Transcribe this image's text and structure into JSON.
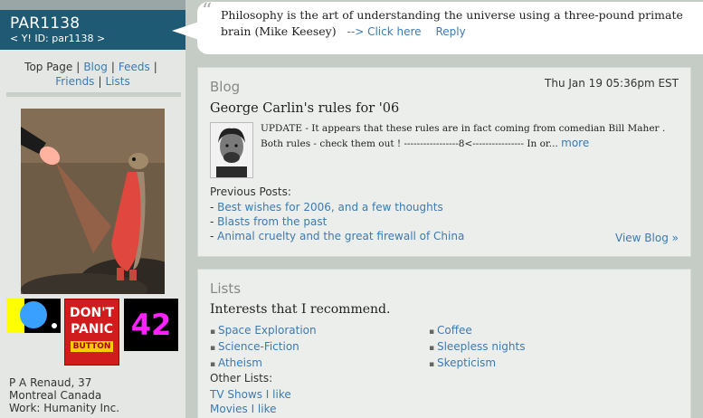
{
  "profile": {
    "name": "PAR1138",
    "yahoo_id": "< Y! ID: par1138 >",
    "info_lines": [
      "P A Renaud, 37",
      "Montreal Canada",
      "Work: Humanity Inc."
    ]
  },
  "nav": {
    "items": [
      "Top Page",
      "Blog",
      "Feeds",
      "Friends",
      "Lists"
    ],
    "separator": "|"
  },
  "badges": {
    "dont_panic": [
      "DON'T",
      "PANIC",
      "BUTTON"
    ],
    "answer": "42"
  },
  "quote": {
    "text": "Philosophy is the art of understanding the universe using a three-pound primate brain (Mike Keesey)",
    "click_link": "--> Click here",
    "reply_link": "Reply"
  },
  "blog": {
    "heading": "Blog",
    "date": "Thu Jan 19 05:36pm EST",
    "post_title": "George Carlin's rules for '06",
    "excerpt": "UPDATE - It appears that these rules are in fact coming from comedian Bill Maher . Both rules - check them out ! -----------------8<---------------- In or...",
    "more_link": "more",
    "previous_heading": "Previous Posts:",
    "previous_posts": [
      "Best wishes for 2006, and a few thoughts",
      "Blasts from the past",
      "Animal cruelty and the great firewall of China"
    ],
    "view_blog": "View Blog »"
  },
  "lists": {
    "heading": "Lists",
    "subheading": "Interests that I recommend.",
    "col1": [
      "Space Exploration",
      "Science-Fiction",
      "Atheism"
    ],
    "col2": [
      "Coffee",
      "Sleepless nights",
      "Skepticism"
    ],
    "other_heading": "Other Lists:",
    "other_lists": [
      "TV Shows I like",
      "Movies I like"
    ]
  }
}
